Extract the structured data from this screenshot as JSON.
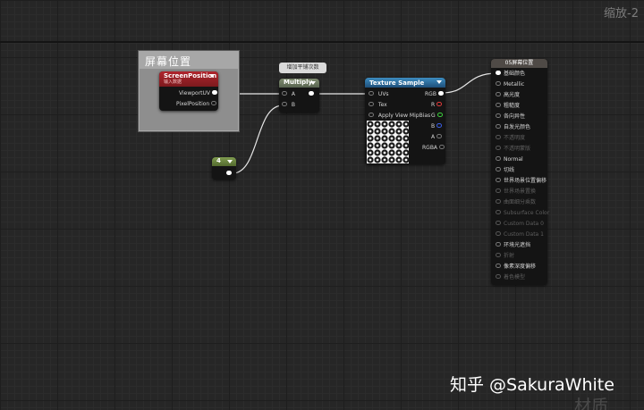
{
  "zoom_label": "缩放-2",
  "comment_title": "屏幕位置",
  "nodes": {
    "screen_position": {
      "title": "ScreenPosition",
      "subtitle": "输入数据",
      "outputs": [
        "ViewportUV",
        "PixelPosition"
      ]
    },
    "multiply": {
      "tooltip": "增加平铺次数",
      "title": "Multiply",
      "inputs": [
        "A",
        "B"
      ]
    },
    "constant": {
      "value": "4"
    },
    "texture_sample": {
      "title": "Texture Sample",
      "inputs": [
        "UVs",
        "Tex",
        "Apply View MipBias"
      ],
      "outputs": [
        "RGB",
        "R",
        "G",
        "B",
        "A",
        "RGBA"
      ]
    },
    "result": {
      "title": "05屏幕位置",
      "pins": [
        {
          "label": "基础颜色",
          "enabled": true
        },
        {
          "label": "Metallic",
          "enabled": true
        },
        {
          "label": "高光度",
          "enabled": true
        },
        {
          "label": "粗糙度",
          "enabled": true
        },
        {
          "label": "各向异性",
          "enabled": true
        },
        {
          "label": "自发光颜色",
          "enabled": true
        },
        {
          "label": "不透明度",
          "enabled": false
        },
        {
          "label": "不透明蒙版",
          "enabled": false
        },
        {
          "label": "Normal",
          "enabled": true
        },
        {
          "label": "切线",
          "enabled": true
        },
        {
          "label": "世界场景位置偏移",
          "enabled": true
        },
        {
          "label": "世界场景置换",
          "enabled": false
        },
        {
          "label": "曲面细分乘数",
          "enabled": false
        },
        {
          "label": "Subsurface Color",
          "enabled": false
        },
        {
          "label": "Custom Data 0",
          "enabled": false
        },
        {
          "label": "Custom Data 1",
          "enabled": false
        },
        {
          "label": "环境光遮挡",
          "enabled": true
        },
        {
          "label": "折射",
          "enabled": false
        },
        {
          "label": "像素深度偏移",
          "enabled": true
        },
        {
          "label": "着色模型",
          "enabled": false
        }
      ]
    }
  },
  "watermark": "知乎 @SakuraWhite",
  "watermark_faint": "材质",
  "colors": {
    "background": "#262626",
    "screen_header": "#b0252d",
    "texture_header": "#3d8dc0",
    "multiply_header": "#7f8c70",
    "constant_header": "#7f9c4f"
  }
}
